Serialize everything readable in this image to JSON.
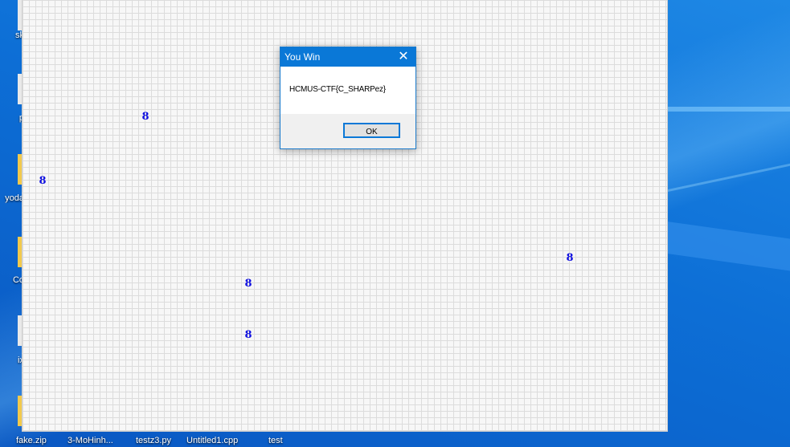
{
  "desktop": {
    "icons": [
      {
        "label": "sk",
        "kind": "file"
      },
      {
        "label": "p",
        "kind": "file"
      },
      {
        "label": "yoda",
        "kind": "folder"
      },
      {
        "label": "Co",
        "kind": "folder"
      },
      {
        "label": "ix",
        "kind": "file"
      },
      {
        "label": "",
        "kind": "folder"
      }
    ],
    "taskbar_labels": [
      "fake.zip",
      "3-MoHinh...",
      "testz3.py",
      "Untitled1.cpp",
      "test"
    ]
  },
  "game": {
    "numbers": [
      "8",
      "8",
      "8",
      "8",
      "8"
    ],
    "number_color": "#1010e0"
  },
  "dialog": {
    "title": "You Win",
    "close_glyph": "✕",
    "message": "HCMUS-CTF{C_SHARPez}",
    "ok_label": "OK",
    "accent": "#0a78d7"
  }
}
